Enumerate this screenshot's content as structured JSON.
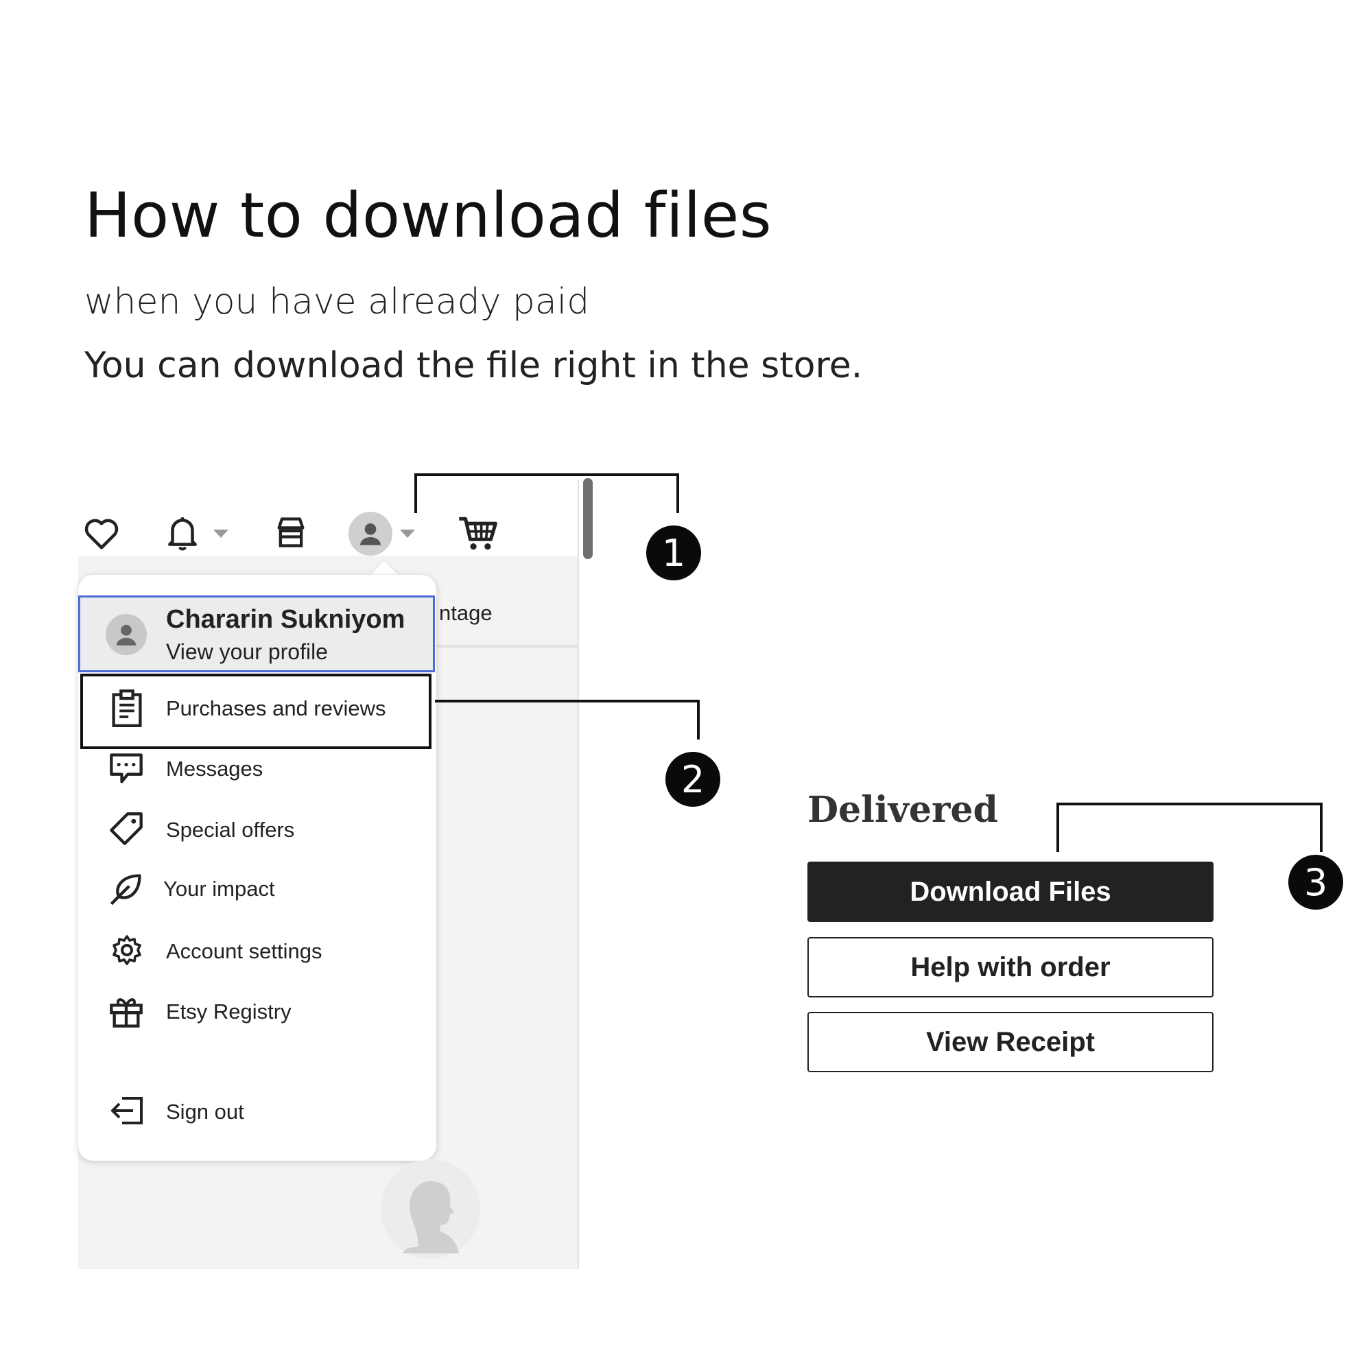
{
  "heading": {
    "title": "How to download files",
    "subtitle": "when you have already paid",
    "description": "You can download the file right in the store."
  },
  "header_icons": {
    "favorites": "heart-icon",
    "notifications": "bell-icon",
    "shop": "shop-icon",
    "account": "avatar-icon",
    "cart": "cart-icon"
  },
  "tab_partial_label": "ntage",
  "dropdown": {
    "profile_name": "Chararin Sukniyom",
    "profile_link": "View your profile",
    "items": [
      {
        "label": "Purchases and reviews",
        "icon": "clipboard-icon"
      },
      {
        "label": "Messages",
        "icon": "chat-icon"
      },
      {
        "label": "Special offers",
        "icon": "tag-icon"
      },
      {
        "label": "Your impact",
        "icon": "leaf-icon"
      },
      {
        "label": "Account settings",
        "icon": "gear-icon"
      },
      {
        "label": "Etsy Registry",
        "icon": "gift-icon"
      },
      {
        "label": "Sign out",
        "icon": "sign-out-icon"
      }
    ]
  },
  "steps": [
    "1",
    "2",
    "3"
  ],
  "order": {
    "status": "Delivered",
    "buttons": {
      "download": "Download Files",
      "help": "Help with order",
      "receipt": "View Receipt"
    }
  },
  "colors": {
    "highlight_border": "#4b6bd6",
    "dark_button": "#222222",
    "badge": "#0a0a0a"
  }
}
